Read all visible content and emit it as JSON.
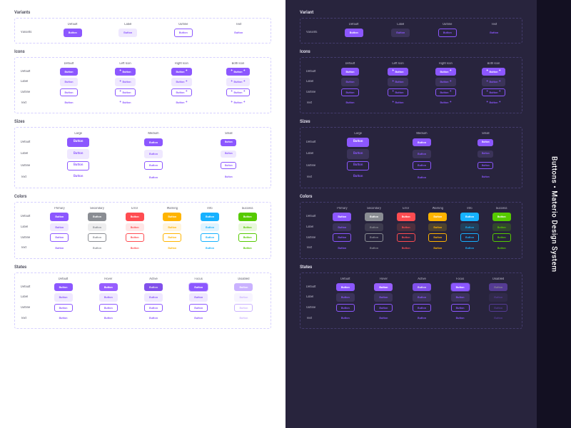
{
  "title_bar": "Buttons • Materio Design System",
  "button_text": "Button",
  "sections": {
    "variants": {
      "title_light": "Variants",
      "title_dark": "Variant",
      "cols": [
        "Default",
        "Label",
        "Outline",
        "Text"
      ],
      "row": "Variants"
    },
    "icons": {
      "title": "Icons",
      "cols": [
        "Default",
        "Left Icon",
        "Right Icon",
        "Both Icon"
      ],
      "rows": [
        "Default",
        "Label",
        "Outline",
        "Text"
      ]
    },
    "sizes": {
      "title": "Sizes",
      "cols": [
        "Large",
        "Medium",
        "Small"
      ],
      "rows": [
        "Default",
        "Label",
        "Outline",
        "Text"
      ]
    },
    "colors": {
      "title": "Colors",
      "cols": [
        "Primary",
        "Secondary",
        "Error",
        "Warning",
        "Info",
        "Success"
      ],
      "rows": [
        "Default",
        "Label",
        "Outline",
        "Text"
      ]
    },
    "states": {
      "title": "States",
      "cols": [
        "Default",
        "Hover",
        "Active",
        "Focus",
        "Disabled"
      ],
      "rows": [
        "Default",
        "Label",
        "Outline",
        "Text"
      ]
    }
  },
  "variant_keys": [
    "default",
    "label",
    "outline",
    "text"
  ],
  "size_keys": [
    "large",
    "medium",
    "small"
  ],
  "color_keys": [
    "primary",
    "secondary",
    "error",
    "warning",
    "info",
    "success"
  ],
  "state_keys": [
    "default",
    "hover",
    "active",
    "focus",
    "disabled"
  ],
  "icon_keys": [
    "none",
    "left",
    "right",
    "both"
  ]
}
